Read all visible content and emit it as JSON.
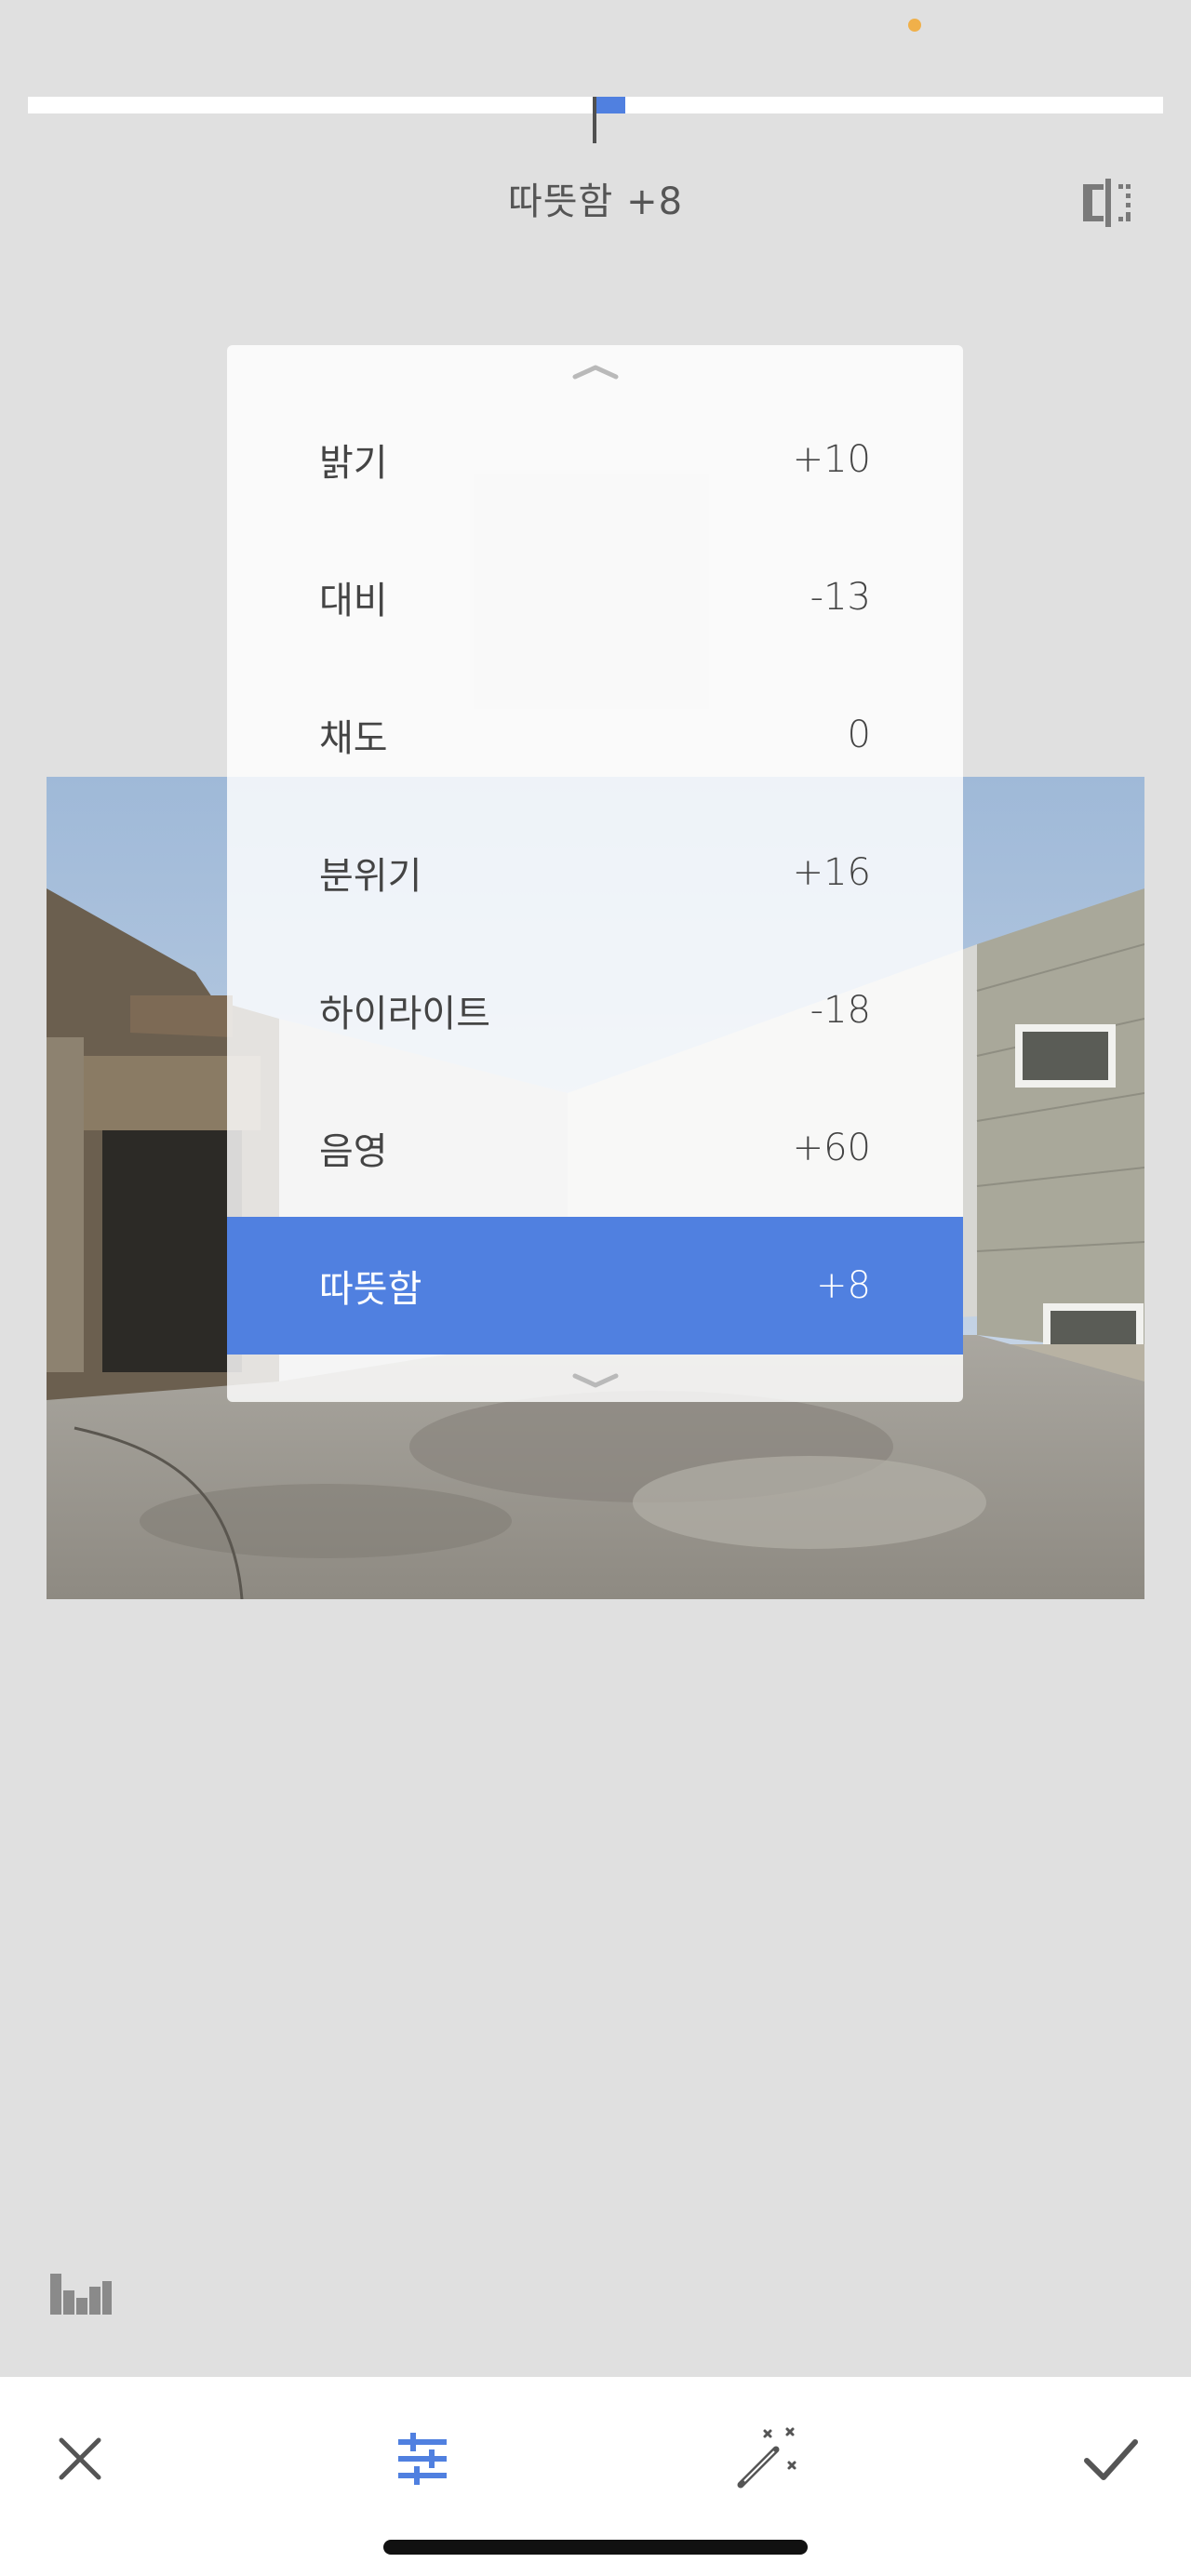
{
  "status": {
    "indicator_color": "#f0b04a"
  },
  "slider": {
    "value": 8,
    "min": -100,
    "max": 100,
    "accent": "#5080e0"
  },
  "header": {
    "adjust_label": "따뜻함 +8"
  },
  "compare_icon": "split-compare-icon",
  "panel": {
    "items": [
      {
        "label": "밝기",
        "value": "+10"
      },
      {
        "label": "대비",
        "value": "-13"
      },
      {
        "label": "채도",
        "value": "0"
      },
      {
        "label": "분위기",
        "value": "+16"
      },
      {
        "label": "하이라이트",
        "value": "-18"
      },
      {
        "label": "음영",
        "value": "+60"
      },
      {
        "label": "따뜻함",
        "value": "+8",
        "selected": true
      }
    ]
  },
  "toolbar": {
    "histogram_icon": "histogram-icon",
    "cancel_icon": "close-icon",
    "adjust_icon": "sliders-icon",
    "auto_icon": "magic-wand-icon",
    "apply_icon": "check-icon"
  },
  "colors": {
    "accent": "#5080e0",
    "background": "#e0e0e0",
    "panel_text": "#444444"
  }
}
